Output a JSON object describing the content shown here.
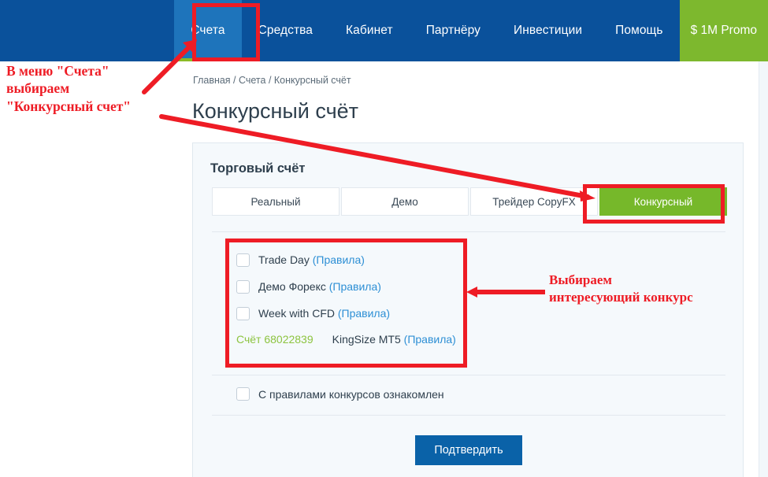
{
  "nav": {
    "items": [
      {
        "label": "Счета",
        "active": true
      },
      {
        "label": "Средства",
        "active": false
      },
      {
        "label": "Кабинет",
        "active": false
      },
      {
        "label": "Партнёру",
        "active": false
      },
      {
        "label": "Инвестиции",
        "active": false
      },
      {
        "label": "Помощь",
        "active": false
      }
    ],
    "promo_label": "$ 1M Promo",
    "bar_color": "#0a519b",
    "active_color": "#1e74bb",
    "active_underline_color": "#8cbb26",
    "promo_color": "#7db82e"
  },
  "breadcrumb": {
    "text": "Главная / Счета / Конкурсный счёт"
  },
  "page": {
    "title": "Конкурсный счёт"
  },
  "card": {
    "title": "Торговый счёт",
    "tabs": [
      {
        "label": "Реальный",
        "active": false
      },
      {
        "label": "Демо",
        "active": false
      },
      {
        "label": "Трейдер CopyFX",
        "active": false
      },
      {
        "label": "Конкурсный",
        "active": true
      }
    ],
    "active_tab_color": "#76b82a",
    "contests": [
      {
        "name": "Trade Day",
        "rules_label": "(Правила)",
        "checked": false
      },
      {
        "name": "Демо Форекс",
        "rules_label": "(Правила)",
        "checked": false
      },
      {
        "name": "Week with CFD",
        "rules_label": "(Правила)",
        "checked": false
      }
    ],
    "account": {
      "number_label": "Счёт 68022839",
      "number_color": "#8dc440",
      "name": "KingSize MT5",
      "rules_label": "(Правила)"
    },
    "agreement": {
      "label": "С правилами конкурсов ознакомлен",
      "checked": false
    },
    "submit_label": "Подтвердить",
    "submit_color": "#0a62a8"
  },
  "annotations": {
    "menu_note": "В меню \"Счета\"\nвыбираем\n\"Конкурсный счет\"",
    "contest_note": "Выбираем\nинтересующий конкурс",
    "color": "#ee1c25"
  }
}
